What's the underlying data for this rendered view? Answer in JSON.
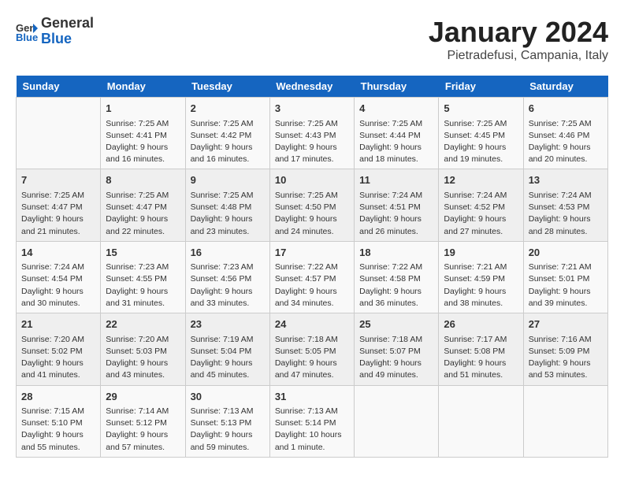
{
  "header": {
    "logo_general": "General",
    "logo_blue": "Blue",
    "title": "January 2024",
    "subtitle": "Pietradefusi, Campania, Italy"
  },
  "columns": [
    "Sunday",
    "Monday",
    "Tuesday",
    "Wednesday",
    "Thursday",
    "Friday",
    "Saturday"
  ],
  "weeks": [
    [
      {
        "num": "",
        "detail": ""
      },
      {
        "num": "1",
        "detail": "Sunrise: 7:25 AM\nSunset: 4:41 PM\nDaylight: 9 hours\nand 16 minutes."
      },
      {
        "num": "2",
        "detail": "Sunrise: 7:25 AM\nSunset: 4:42 PM\nDaylight: 9 hours\nand 16 minutes."
      },
      {
        "num": "3",
        "detail": "Sunrise: 7:25 AM\nSunset: 4:43 PM\nDaylight: 9 hours\nand 17 minutes."
      },
      {
        "num": "4",
        "detail": "Sunrise: 7:25 AM\nSunset: 4:44 PM\nDaylight: 9 hours\nand 18 minutes."
      },
      {
        "num": "5",
        "detail": "Sunrise: 7:25 AM\nSunset: 4:45 PM\nDaylight: 9 hours\nand 19 minutes."
      },
      {
        "num": "6",
        "detail": "Sunrise: 7:25 AM\nSunset: 4:46 PM\nDaylight: 9 hours\nand 20 minutes."
      }
    ],
    [
      {
        "num": "7",
        "detail": "Sunrise: 7:25 AM\nSunset: 4:47 PM\nDaylight: 9 hours\nand 21 minutes."
      },
      {
        "num": "8",
        "detail": "Sunrise: 7:25 AM\nSunset: 4:47 PM\nDaylight: 9 hours\nand 22 minutes."
      },
      {
        "num": "9",
        "detail": "Sunrise: 7:25 AM\nSunset: 4:48 PM\nDaylight: 9 hours\nand 23 minutes."
      },
      {
        "num": "10",
        "detail": "Sunrise: 7:25 AM\nSunset: 4:50 PM\nDaylight: 9 hours\nand 24 minutes."
      },
      {
        "num": "11",
        "detail": "Sunrise: 7:24 AM\nSunset: 4:51 PM\nDaylight: 9 hours\nand 26 minutes."
      },
      {
        "num": "12",
        "detail": "Sunrise: 7:24 AM\nSunset: 4:52 PM\nDaylight: 9 hours\nand 27 minutes."
      },
      {
        "num": "13",
        "detail": "Sunrise: 7:24 AM\nSunset: 4:53 PM\nDaylight: 9 hours\nand 28 minutes."
      }
    ],
    [
      {
        "num": "14",
        "detail": "Sunrise: 7:24 AM\nSunset: 4:54 PM\nDaylight: 9 hours\nand 30 minutes."
      },
      {
        "num": "15",
        "detail": "Sunrise: 7:23 AM\nSunset: 4:55 PM\nDaylight: 9 hours\nand 31 minutes."
      },
      {
        "num": "16",
        "detail": "Sunrise: 7:23 AM\nSunset: 4:56 PM\nDaylight: 9 hours\nand 33 minutes."
      },
      {
        "num": "17",
        "detail": "Sunrise: 7:22 AM\nSunset: 4:57 PM\nDaylight: 9 hours\nand 34 minutes."
      },
      {
        "num": "18",
        "detail": "Sunrise: 7:22 AM\nSunset: 4:58 PM\nDaylight: 9 hours\nand 36 minutes."
      },
      {
        "num": "19",
        "detail": "Sunrise: 7:21 AM\nSunset: 4:59 PM\nDaylight: 9 hours\nand 38 minutes."
      },
      {
        "num": "20",
        "detail": "Sunrise: 7:21 AM\nSunset: 5:01 PM\nDaylight: 9 hours\nand 39 minutes."
      }
    ],
    [
      {
        "num": "21",
        "detail": "Sunrise: 7:20 AM\nSunset: 5:02 PM\nDaylight: 9 hours\nand 41 minutes."
      },
      {
        "num": "22",
        "detail": "Sunrise: 7:20 AM\nSunset: 5:03 PM\nDaylight: 9 hours\nand 43 minutes."
      },
      {
        "num": "23",
        "detail": "Sunrise: 7:19 AM\nSunset: 5:04 PM\nDaylight: 9 hours\nand 45 minutes."
      },
      {
        "num": "24",
        "detail": "Sunrise: 7:18 AM\nSunset: 5:05 PM\nDaylight: 9 hours\nand 47 minutes."
      },
      {
        "num": "25",
        "detail": "Sunrise: 7:18 AM\nSunset: 5:07 PM\nDaylight: 9 hours\nand 49 minutes."
      },
      {
        "num": "26",
        "detail": "Sunrise: 7:17 AM\nSunset: 5:08 PM\nDaylight: 9 hours\nand 51 minutes."
      },
      {
        "num": "27",
        "detail": "Sunrise: 7:16 AM\nSunset: 5:09 PM\nDaylight: 9 hours\nand 53 minutes."
      }
    ],
    [
      {
        "num": "28",
        "detail": "Sunrise: 7:15 AM\nSunset: 5:10 PM\nDaylight: 9 hours\nand 55 minutes."
      },
      {
        "num": "29",
        "detail": "Sunrise: 7:14 AM\nSunset: 5:12 PM\nDaylight: 9 hours\nand 57 minutes."
      },
      {
        "num": "30",
        "detail": "Sunrise: 7:13 AM\nSunset: 5:13 PM\nDaylight: 9 hours\nand 59 minutes."
      },
      {
        "num": "31",
        "detail": "Sunrise: 7:13 AM\nSunset: 5:14 PM\nDaylight: 10 hours\nand 1 minute."
      },
      {
        "num": "",
        "detail": ""
      },
      {
        "num": "",
        "detail": ""
      },
      {
        "num": "",
        "detail": ""
      }
    ]
  ]
}
